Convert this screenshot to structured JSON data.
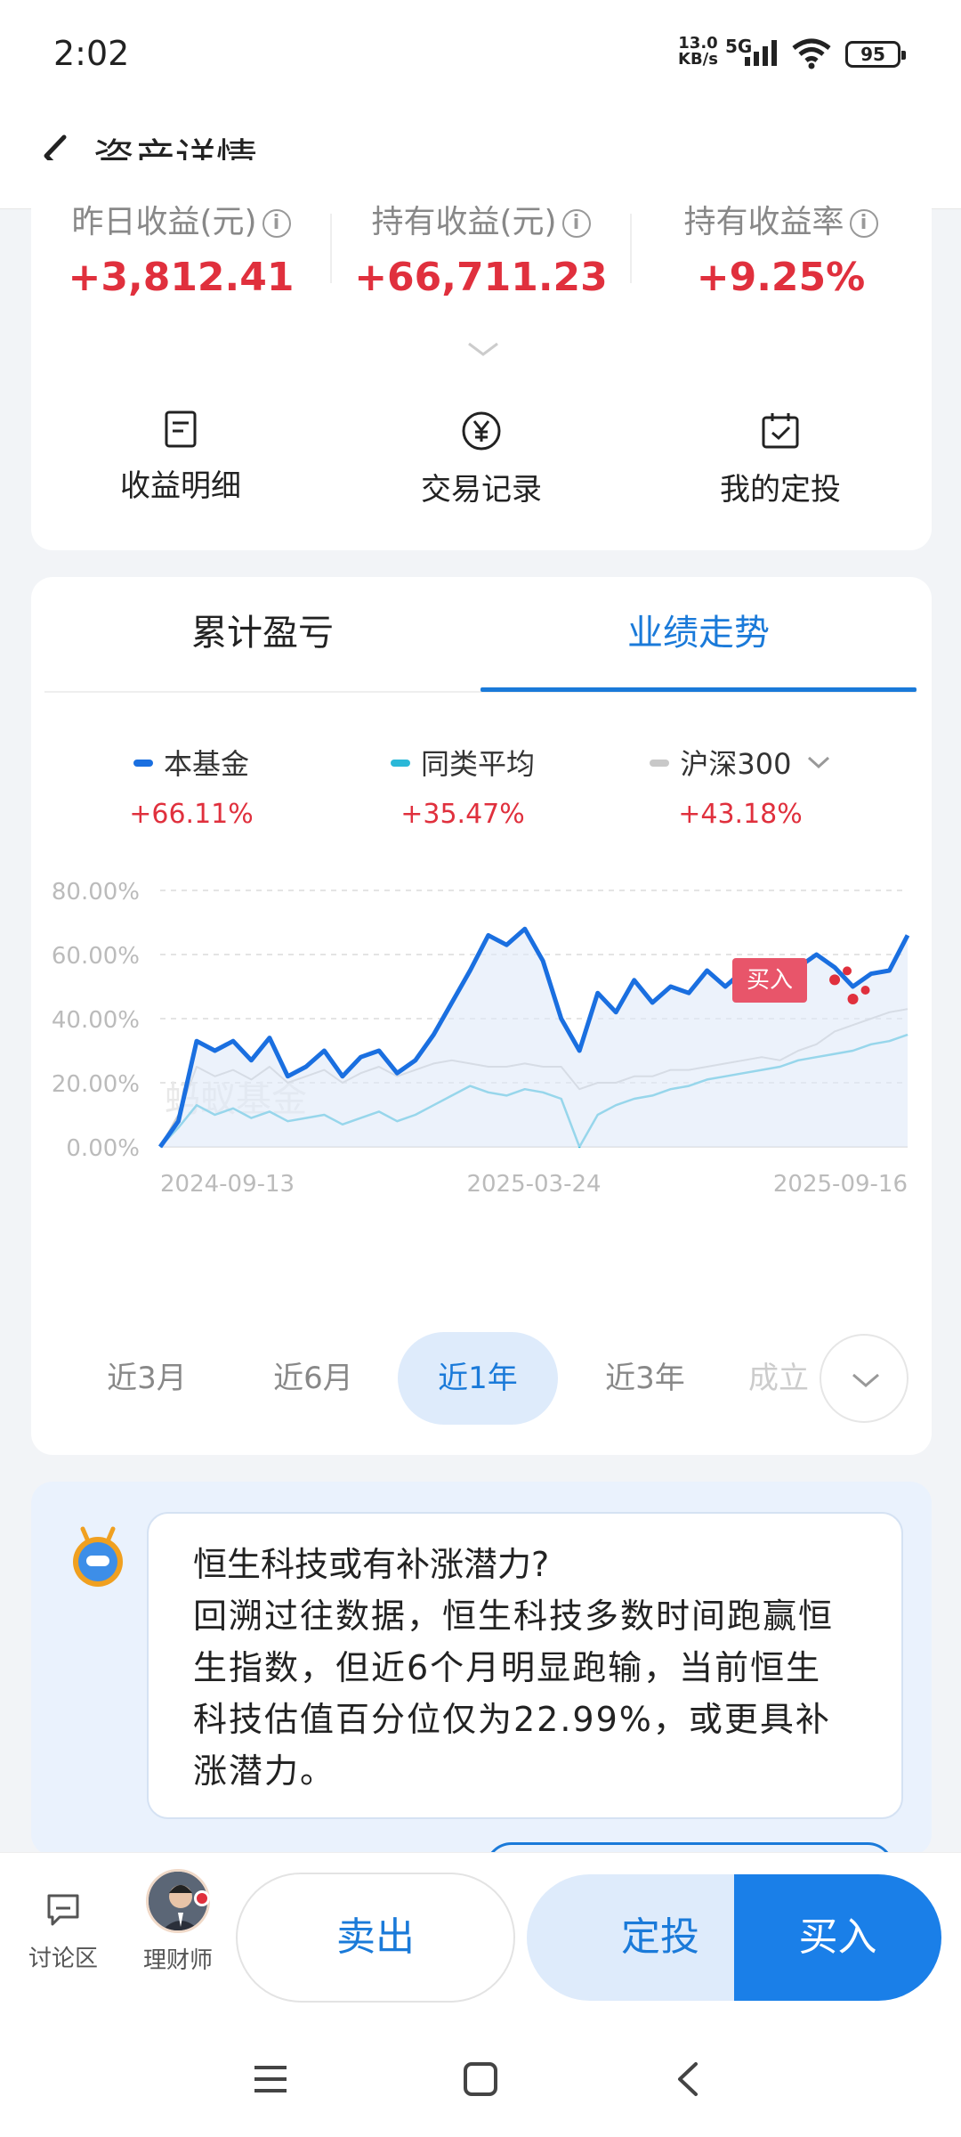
{
  "status": {
    "time": "2:02",
    "net_speed_top": "13.0",
    "net_speed_unit": "KB/s",
    "network": "5G",
    "battery": "95"
  },
  "header": {
    "title": "资产详情",
    "back_icon": "chevron-left-icon"
  },
  "summary": {
    "stats": [
      {
        "label": "昨日收益(元)",
        "value": "+3,812.41"
      },
      {
        "label": "持有收益(元)",
        "value": "+66,711.23"
      },
      {
        "label": "持有收益率",
        "value": "+9.25%"
      }
    ],
    "info_glyph": "i",
    "actions": [
      {
        "label": "收益明细",
        "icon": "document-icon"
      },
      {
        "label": "交易记录",
        "icon": "yen-circle-icon"
      },
      {
        "label": "我的定投",
        "icon": "calendar-check-icon"
      }
    ]
  },
  "performance": {
    "tabs": [
      "累计盈亏",
      "业绩走势"
    ],
    "active_tab": 1,
    "legend": [
      {
        "name": "本基金",
        "value": "+66.11%",
        "color": "#1a6fe0"
      },
      {
        "name": "同类平均",
        "value": "+35.47%",
        "color": "#2bb8d8"
      },
      {
        "name": "沪深300",
        "value": "+43.18%",
        "color": "#c8c8c8"
      }
    ],
    "watermark": "蚂蚁基金",
    "buy_marker": "买入",
    "ranges": [
      "近3月",
      "近6月",
      "近1年",
      "近3年",
      "成立"
    ],
    "active_range": 2
  },
  "chart_data": {
    "type": "line",
    "y_ticks": [
      "80.00%",
      "60.00%",
      "40.00%",
      "20.00%",
      "0.00%"
    ],
    "x_ticks": [
      "2024-09-13",
      "2025-03-24",
      "2025-09-16"
    ],
    "ylim": [
      0,
      80
    ],
    "grid": true,
    "series": [
      {
        "name": "本基金",
        "values": [
          0,
          8,
          33,
          30,
          33,
          27,
          34,
          22,
          25,
          30,
          22,
          28,
          30,
          23,
          27,
          35,
          45,
          55,
          66,
          63,
          68,
          58,
          40,
          30,
          48,
          42,
          52,
          45,
          50,
          48,
          55,
          50,
          55,
          48,
          52,
          56,
          60,
          56,
          50,
          54,
          55,
          66
        ]
      },
      {
        "name": "同类平均",
        "values": [
          0,
          6,
          13,
          10,
          12,
          9,
          11,
          8,
          9,
          10,
          7,
          9,
          11,
          8,
          10,
          13,
          16,
          19,
          17,
          16,
          18,
          17,
          15,
          0,
          10,
          13,
          15,
          16,
          18,
          19,
          21,
          22,
          23,
          24,
          25,
          27,
          28,
          29,
          30,
          32,
          33,
          35
        ]
      },
      {
        "name": "沪深300",
        "values": [
          0,
          10,
          25,
          22,
          24,
          21,
          25,
          20,
          22,
          24,
          20,
          23,
          25,
          22,
          24,
          26,
          27,
          26,
          25,
          25,
          26,
          25,
          25,
          18,
          20,
          20,
          22,
          22,
          24,
          24,
          25,
          26,
          27,
          28,
          27,
          30,
          32,
          36,
          38,
          40,
          42,
          43
        ]
      }
    ]
  },
  "insight": {
    "title": "恒生科技或有补涨潜力?",
    "body": "回溯过往数据，恒生科技多数时间跑赢恒生指数，但近6个月明显跑输，当前恒生科技估值百分位仅为22.99%，或更具补涨潜力。"
  },
  "bottom": {
    "discuss_label": "讨论区",
    "advisor_label": "理财师",
    "sell_label": "卖出",
    "plan_label": "定投",
    "buy_label": "买入"
  }
}
